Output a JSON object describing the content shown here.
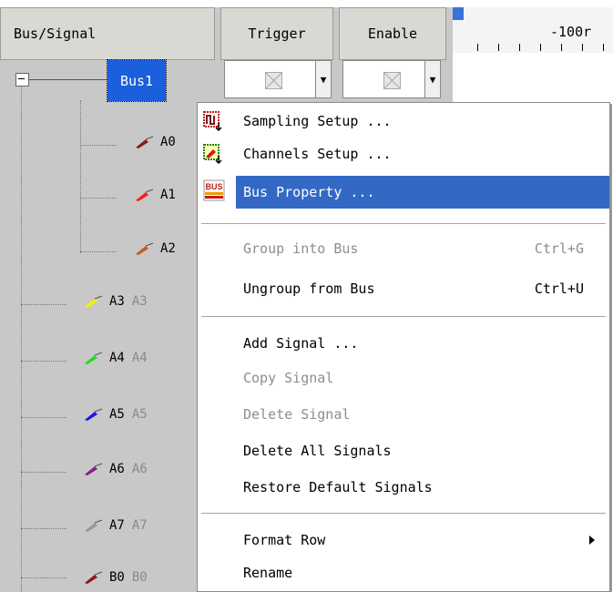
{
  "header": {
    "bus_signal": "Bus/Signal",
    "trigger": "Trigger",
    "enable": "Enable"
  },
  "ruler": {
    "label": "-100r"
  },
  "tree": {
    "bus": "Bus1",
    "signals": [
      {
        "name": "A0",
        "alias": "",
        "color": "#8b1a1a"
      },
      {
        "name": "A1",
        "alias": "",
        "color": "#ff1a1a"
      },
      {
        "name": "A2",
        "alias": "",
        "color": "#c85a1a"
      },
      {
        "name": "A3",
        "alias": "A3",
        "color": "#f2f200"
      },
      {
        "name": "A4",
        "alias": "A4",
        "color": "#22dd22"
      },
      {
        "name": "A5",
        "alias": "A5",
        "color": "#1a1add"
      },
      {
        "name": "A6",
        "alias": "A6",
        "color": "#8a1a8a"
      },
      {
        "name": "A7",
        "alias": "A7",
        "color": "#9a9a9a"
      },
      {
        "name": "B0",
        "alias": "B0",
        "color": "#8b1a1a"
      }
    ]
  },
  "menu": {
    "sampling_setup": "Sampling Setup ...",
    "channels_setup": "Channels Setup ...",
    "bus_property": "Bus Property ...",
    "bus_icon_text": "BUS",
    "group_into_bus": "Group into Bus",
    "group_into_bus_shortcut": "Ctrl+G",
    "ungroup_from_bus": "Ungroup from Bus",
    "ungroup_from_bus_shortcut": "Ctrl+U",
    "add_signal": "Add Signal ...",
    "copy_signal": "Copy Signal",
    "delete_signal": "Delete Signal",
    "delete_all_signals": "Delete All Signals",
    "restore_default_signals": "Restore Default Signals",
    "format_row": "Format Row",
    "rename": "Rename"
  }
}
